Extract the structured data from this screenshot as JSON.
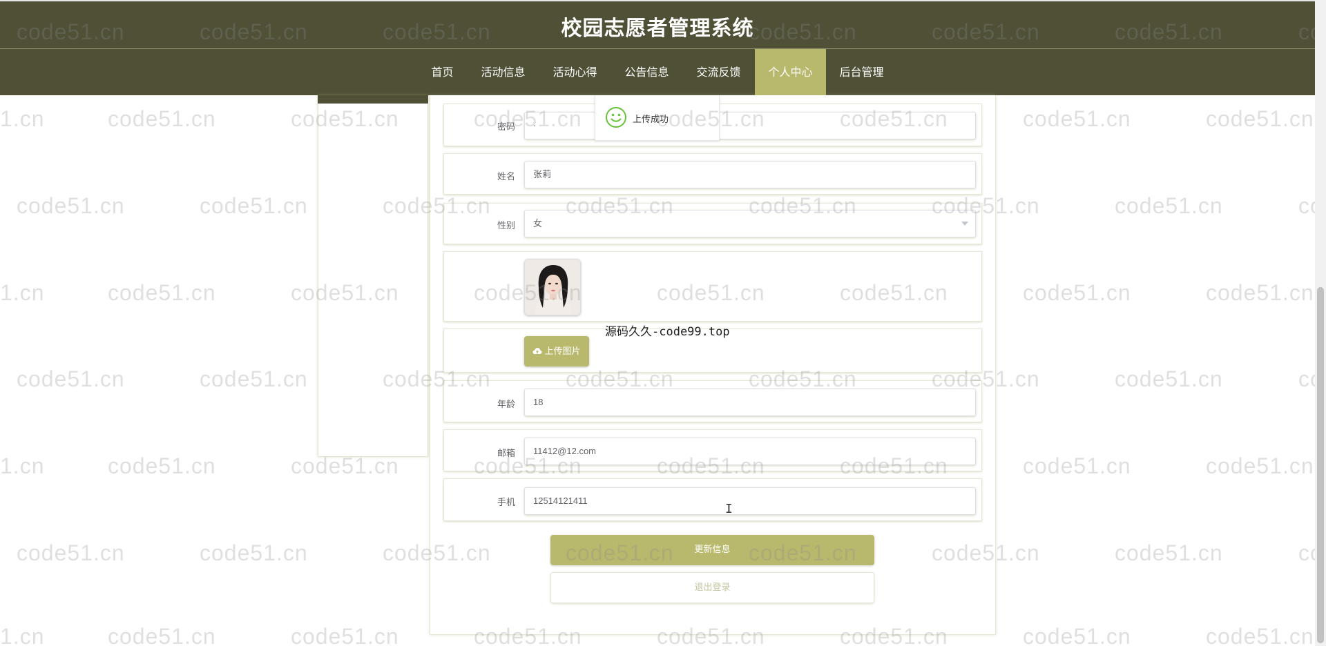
{
  "site": {
    "title": "校园志愿者管理系统"
  },
  "nav": {
    "items": [
      {
        "label": "首页",
        "active": false
      },
      {
        "label": "活动信息",
        "active": false
      },
      {
        "label": "活动心得",
        "active": false
      },
      {
        "label": "公告信息",
        "active": false
      },
      {
        "label": "交流反馈",
        "active": false
      },
      {
        "label": "个人中心",
        "active": true
      },
      {
        "label": "后台管理",
        "active": false
      }
    ]
  },
  "toast": {
    "message": "上传成功",
    "icon": "smile-icon"
  },
  "form": {
    "password": {
      "label": "密码",
      "value": "·"
    },
    "name": {
      "label": "姓名",
      "value": "张莉"
    },
    "gender": {
      "label": "性别",
      "value": "女"
    },
    "upload": {
      "button_label": "上传图片",
      "icon": "cloud-upload-icon"
    },
    "age": {
      "label": "年龄",
      "value": "18"
    },
    "email": {
      "label": "邮箱",
      "value": "11412@12.com"
    },
    "phone": {
      "label": "手机",
      "value": "12514121411"
    }
  },
  "actions": {
    "update_label": "更新信息",
    "logout_label": "退出登录"
  },
  "overlay": {
    "caption": "源码久久-code99.top"
  },
  "watermark": {
    "text": "code51.cn",
    "partial_left": "1.cn",
    "partial_right": "co"
  },
  "colors": {
    "header_bg": "#4f5036",
    "accent": "#b8b96c",
    "toast_icon": "#67c23a"
  }
}
